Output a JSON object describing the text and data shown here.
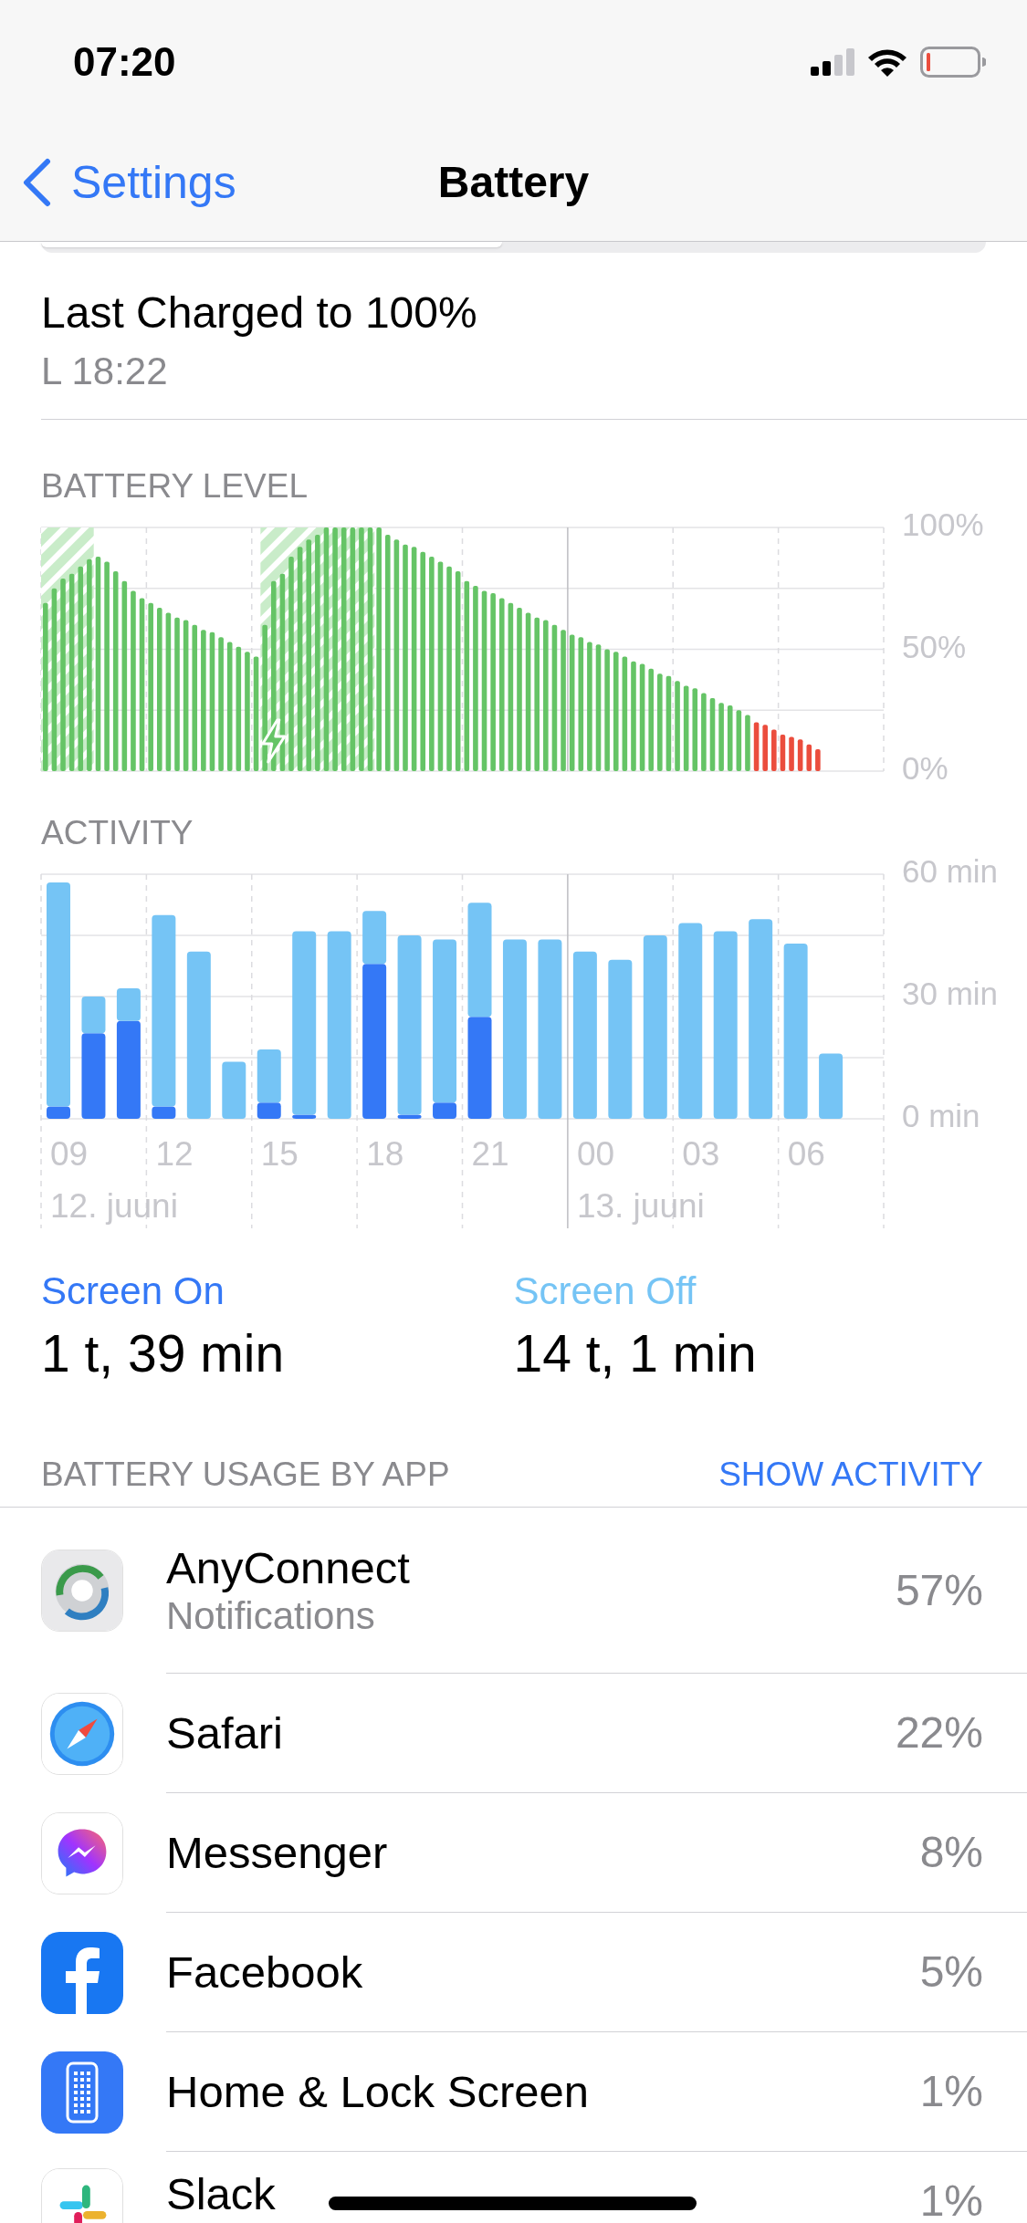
{
  "status_bar": {
    "time": "07:20"
  },
  "nav": {
    "back": "Settings",
    "title": "Battery"
  },
  "last_charged": {
    "title": "Last Charged to 100%",
    "time": "L 18:22"
  },
  "battery_level": {
    "chart_data": {
      "type": "bar",
      "title": "BATTERY LEVEL",
      "ylim": [
        0,
        100
      ],
      "yticks": [
        {
          "value": 0,
          "label": "0%"
        },
        {
          "value": 50,
          "label": "50%"
        },
        {
          "value": 100,
          "label": "100%"
        }
      ],
      "series": [
        {
          "color": "#65c466",
          "values": [
            69,
            75,
            79,
            81,
            84,
            87,
            88,
            86,
            82,
            78,
            74,
            71,
            69,
            67,
            65,
            63,
            62,
            60,
            58,
            57,
            55,
            53,
            51,
            49,
            47,
            60,
            78,
            81,
            88,
            92,
            95,
            97,
            100,
            100,
            100,
            100,
            100,
            100,
            100,
            97,
            95,
            93,
            92,
            90,
            88,
            86,
            84,
            82,
            78,
            76,
            74,
            73,
            71,
            69,
            67,
            65,
            63,
            62,
            60,
            58,
            56,
            55,
            53,
            52,
            50,
            49,
            47,
            45,
            44,
            42,
            40,
            39,
            37,
            35,
            34,
            32,
            30,
            28,
            27,
            25,
            23,
            null,
            null,
            null,
            null,
            null,
            null,
            null,
            null,
            null,
            null,
            null,
            null,
            null,
            null,
            null
          ]
        },
        {
          "color": "#eb4d3d",
          "values": [
            null,
            null,
            null,
            null,
            null,
            null,
            null,
            null,
            null,
            null,
            null,
            null,
            null,
            null,
            null,
            null,
            null,
            null,
            null,
            null,
            null,
            null,
            null,
            null,
            null,
            null,
            null,
            null,
            null,
            null,
            null,
            null,
            null,
            null,
            null,
            null,
            null,
            null,
            null,
            null,
            null,
            null,
            null,
            null,
            null,
            null,
            null,
            null,
            null,
            null,
            null,
            null,
            null,
            null,
            null,
            null,
            null,
            null,
            null,
            null,
            null,
            null,
            null,
            null,
            null,
            null,
            null,
            null,
            null,
            null,
            null,
            null,
            null,
            null,
            null,
            null,
            null,
            null,
            null,
            null,
            null,
            20,
            19,
            17,
            15,
            14,
            13,
            11,
            9,
            null,
            null,
            null,
            null,
            null,
            null,
            null
          ]
        }
      ]
    }
  },
  "activity": {
    "chart_data": {
      "type": "bar",
      "title": "ACTIVITY",
      "stacked": true,
      "ylim": [
        0,
        60
      ],
      "yticks": [
        {
          "value": 0,
          "label": "0 min"
        },
        {
          "value": 30,
          "label": "30 min"
        },
        {
          "value": 60,
          "label": "60 min"
        }
      ],
      "series": [
        {
          "name": "Screen On",
          "color": "#3478f6",
          "values": [
            3,
            21,
            24,
            3,
            0,
            0,
            4,
            1,
            0,
            38,
            1,
            4,
            25,
            0,
            0,
            0,
            0,
            0,
            0,
            0,
            0,
            0,
            0,
            null
          ]
        },
        {
          "name": "Screen Off",
          "color": "#75c4f5",
          "values": [
            55,
            9,
            8,
            47,
            41,
            14,
            13,
            45,
            46,
            13,
            44,
            40,
            28,
            44,
            44,
            41,
            39,
            45,
            48,
            46,
            49,
            43,
            16,
            null
          ]
        }
      ]
    },
    "hour_labels": [
      "09",
      "12",
      "15",
      "18",
      "21",
      "00",
      "03",
      "06"
    ],
    "date_labels": [
      "12. juuni",
      "13. juuni"
    ]
  },
  "screen_time": [
    "1 t, 39 min",
    "14 t, 1 min"
  ],
  "usage": {
    "title": "BATTERY USAGE BY APP",
    "action": "SHOW ACTIVITY",
    "apps": [
      {
        "kind": "vpn",
        "name": "AnyConnect",
        "detail": "Notifications",
        "percent": "57%"
      },
      {
        "kind": "browser",
        "name": "Safari",
        "percent": "22%"
      },
      {
        "kind": "messenger",
        "name": "Messenger",
        "percent": "8%"
      },
      {
        "kind": "social",
        "name": "Facebook",
        "percent": "5%"
      },
      {
        "kind": "homescreen",
        "name": "Home & Lock Screen",
        "percent": "1%"
      },
      {
        "kind": "chat",
        "name": "Slack",
        "percent": "1%"
      }
    ]
  }
}
